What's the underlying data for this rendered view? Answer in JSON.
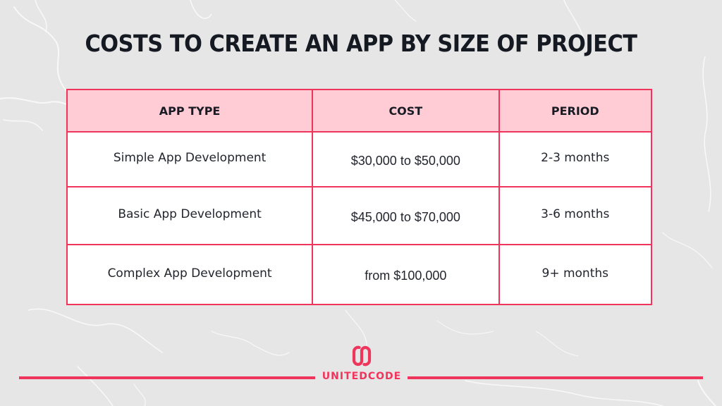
{
  "title": "COSTS TO CREATE AN APP BY SIZE OF PROJECT",
  "table": {
    "headers": [
      "APP TYPE",
      "COST",
      "PERIOD"
    ],
    "rows": [
      {
        "app_type": "Simple App Development",
        "cost": "$30,000 to $50,000",
        "period": "2-3 months"
      },
      {
        "app_type": "Basic App Development",
        "cost": "$45,000 to $70,000",
        "period": "3-6 months"
      },
      {
        "app_type": "Complex App Development",
        "cost": "from $100,000",
        "period": "9+ months"
      }
    ]
  },
  "brand": {
    "name": "UNITEDCODE",
    "logo_icon": "unitedcode-s-logo-icon"
  },
  "colors": {
    "accent": "#f0355c",
    "header_bg": "#ffcbd5",
    "background": "#e6e6e6",
    "title": "#151922"
  }
}
